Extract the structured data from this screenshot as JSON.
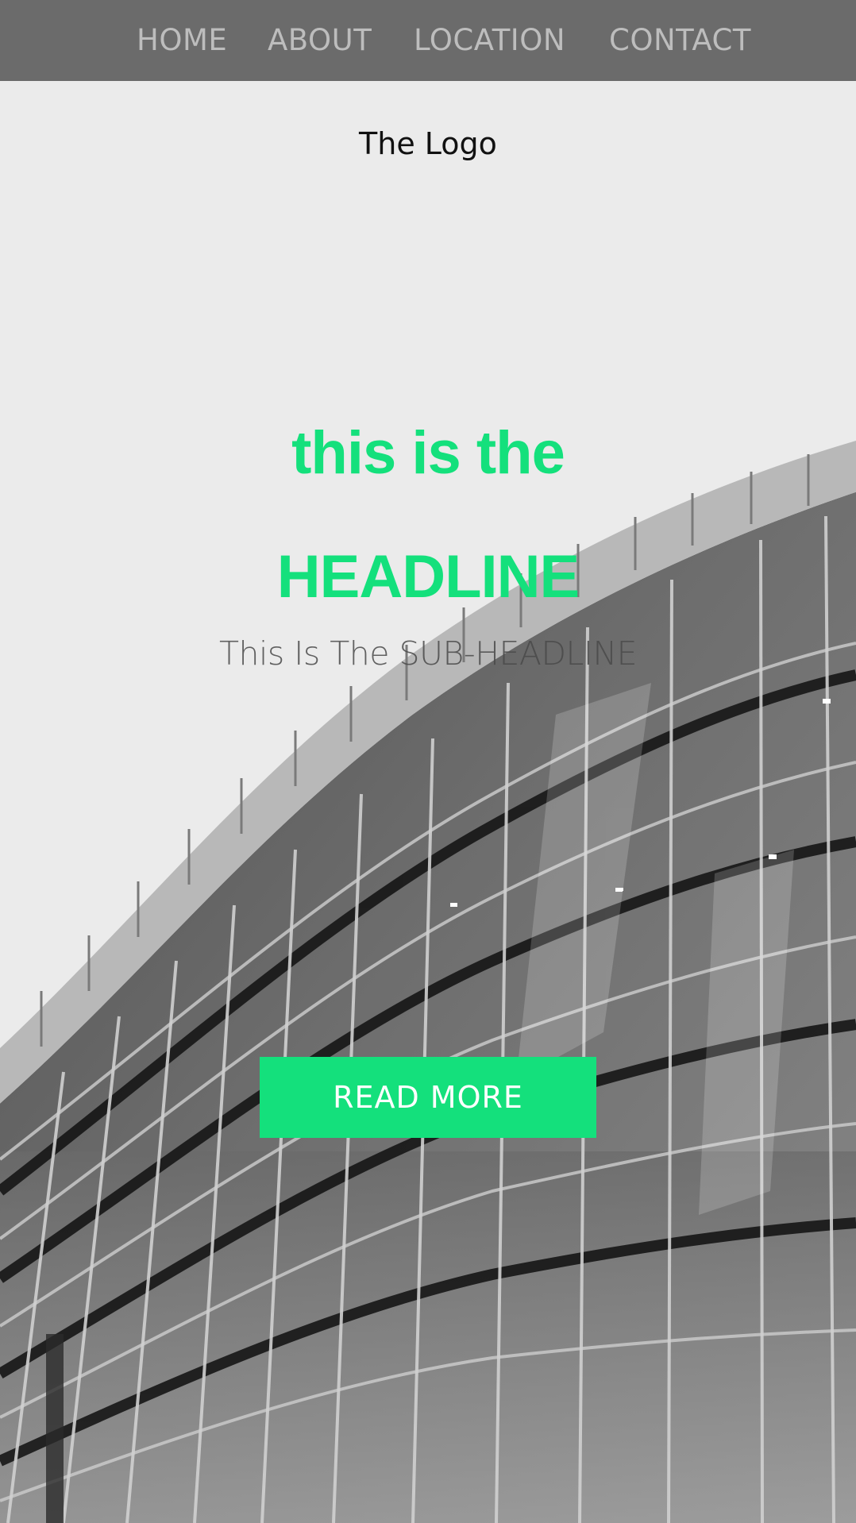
{
  "nav": {
    "items": [
      {
        "label": "HOME"
      },
      {
        "label": "ABOUT"
      },
      {
        "label": "LOCATION"
      },
      {
        "label": "CONTACT"
      }
    ]
  },
  "logo": {
    "text": "The Logo"
  },
  "hero": {
    "headline_line1": "this is the",
    "headline_line2": "HEADLINE",
    "subheadline": "This Is The SUB-HEADLINE",
    "cta_label": "READ MORE",
    "image": "building-facade-photo"
  },
  "colors": {
    "accent": "#14e07c",
    "nav_background": "#6b6b6b",
    "nav_text": "#bdbdbd",
    "page_background": "#ebebeb"
  }
}
